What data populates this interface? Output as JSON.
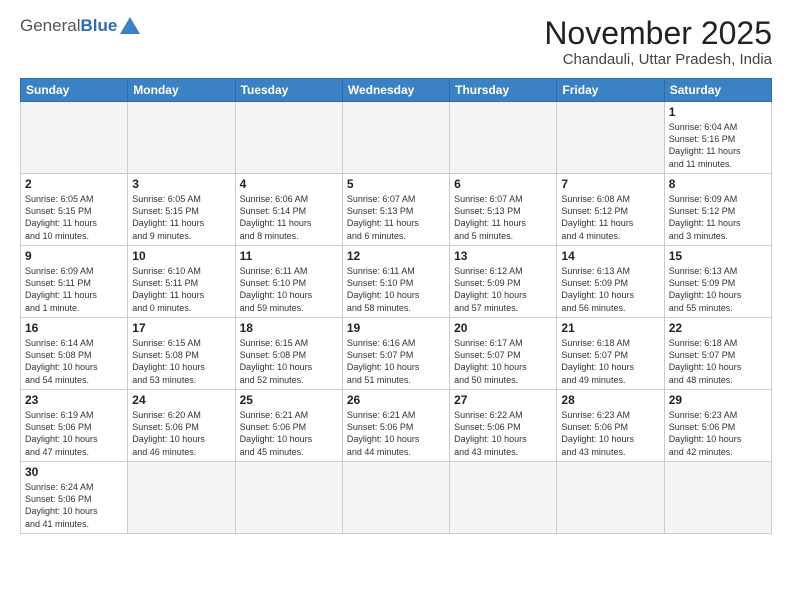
{
  "logo": {
    "general": "General",
    "blue": "Blue"
  },
  "title": "November 2025",
  "subtitle": "Chandauli, Uttar Pradesh, India",
  "weekdays": [
    "Sunday",
    "Monday",
    "Tuesday",
    "Wednesday",
    "Thursday",
    "Friday",
    "Saturday"
  ],
  "days": [
    {
      "date": "",
      "info": ""
    },
    {
      "date": "",
      "info": ""
    },
    {
      "date": "",
      "info": ""
    },
    {
      "date": "",
      "info": ""
    },
    {
      "date": "",
      "info": ""
    },
    {
      "date": "",
      "info": ""
    },
    {
      "date": "1",
      "info": "Sunrise: 6:04 AM\nSunset: 5:16 PM\nDaylight: 11 hours\nand 11 minutes."
    },
    {
      "date": "2",
      "info": "Sunrise: 6:05 AM\nSunset: 5:15 PM\nDaylight: 11 hours\nand 10 minutes."
    },
    {
      "date": "3",
      "info": "Sunrise: 6:05 AM\nSunset: 5:15 PM\nDaylight: 11 hours\nand 9 minutes."
    },
    {
      "date": "4",
      "info": "Sunrise: 6:06 AM\nSunset: 5:14 PM\nDaylight: 11 hours\nand 8 minutes."
    },
    {
      "date": "5",
      "info": "Sunrise: 6:07 AM\nSunset: 5:13 PM\nDaylight: 11 hours\nand 6 minutes."
    },
    {
      "date": "6",
      "info": "Sunrise: 6:07 AM\nSunset: 5:13 PM\nDaylight: 11 hours\nand 5 minutes."
    },
    {
      "date": "7",
      "info": "Sunrise: 6:08 AM\nSunset: 5:12 PM\nDaylight: 11 hours\nand 4 minutes."
    },
    {
      "date": "8",
      "info": "Sunrise: 6:09 AM\nSunset: 5:12 PM\nDaylight: 11 hours\nand 3 minutes."
    },
    {
      "date": "9",
      "info": "Sunrise: 6:09 AM\nSunset: 5:11 PM\nDaylight: 11 hours\nand 1 minute."
    },
    {
      "date": "10",
      "info": "Sunrise: 6:10 AM\nSunset: 5:11 PM\nDaylight: 11 hours\nand 0 minutes."
    },
    {
      "date": "11",
      "info": "Sunrise: 6:11 AM\nSunset: 5:10 PM\nDaylight: 10 hours\nand 59 minutes."
    },
    {
      "date": "12",
      "info": "Sunrise: 6:11 AM\nSunset: 5:10 PM\nDaylight: 10 hours\nand 58 minutes."
    },
    {
      "date": "13",
      "info": "Sunrise: 6:12 AM\nSunset: 5:09 PM\nDaylight: 10 hours\nand 57 minutes."
    },
    {
      "date": "14",
      "info": "Sunrise: 6:13 AM\nSunset: 5:09 PM\nDaylight: 10 hours\nand 56 minutes."
    },
    {
      "date": "15",
      "info": "Sunrise: 6:13 AM\nSunset: 5:09 PM\nDaylight: 10 hours\nand 55 minutes."
    },
    {
      "date": "16",
      "info": "Sunrise: 6:14 AM\nSunset: 5:08 PM\nDaylight: 10 hours\nand 54 minutes."
    },
    {
      "date": "17",
      "info": "Sunrise: 6:15 AM\nSunset: 5:08 PM\nDaylight: 10 hours\nand 53 minutes."
    },
    {
      "date": "18",
      "info": "Sunrise: 6:15 AM\nSunset: 5:08 PM\nDaylight: 10 hours\nand 52 minutes."
    },
    {
      "date": "19",
      "info": "Sunrise: 6:16 AM\nSunset: 5:07 PM\nDaylight: 10 hours\nand 51 minutes."
    },
    {
      "date": "20",
      "info": "Sunrise: 6:17 AM\nSunset: 5:07 PM\nDaylight: 10 hours\nand 50 minutes."
    },
    {
      "date": "21",
      "info": "Sunrise: 6:18 AM\nSunset: 5:07 PM\nDaylight: 10 hours\nand 49 minutes."
    },
    {
      "date": "22",
      "info": "Sunrise: 6:18 AM\nSunset: 5:07 PM\nDaylight: 10 hours\nand 48 minutes."
    },
    {
      "date": "23",
      "info": "Sunrise: 6:19 AM\nSunset: 5:06 PM\nDaylight: 10 hours\nand 47 minutes."
    },
    {
      "date": "24",
      "info": "Sunrise: 6:20 AM\nSunset: 5:06 PM\nDaylight: 10 hours\nand 46 minutes."
    },
    {
      "date": "25",
      "info": "Sunrise: 6:21 AM\nSunset: 5:06 PM\nDaylight: 10 hours\nand 45 minutes."
    },
    {
      "date": "26",
      "info": "Sunrise: 6:21 AM\nSunset: 5:06 PM\nDaylight: 10 hours\nand 44 minutes."
    },
    {
      "date": "27",
      "info": "Sunrise: 6:22 AM\nSunset: 5:06 PM\nDaylight: 10 hours\nand 43 minutes."
    },
    {
      "date": "28",
      "info": "Sunrise: 6:23 AM\nSunset: 5:06 PM\nDaylight: 10 hours\nand 43 minutes."
    },
    {
      "date": "29",
      "info": "Sunrise: 6:23 AM\nSunset: 5:06 PM\nDaylight: 10 hours\nand 42 minutes."
    },
    {
      "date": "30",
      "info": "Sunrise: 6:24 AM\nSunset: 5:06 PM\nDaylight: 10 hours\nand 41 minutes."
    },
    {
      "date": "",
      "info": ""
    },
    {
      "date": "",
      "info": ""
    },
    {
      "date": "",
      "info": ""
    },
    {
      "date": "",
      "info": ""
    },
    {
      "date": "",
      "info": ""
    },
    {
      "date": "",
      "info": ""
    }
  ]
}
